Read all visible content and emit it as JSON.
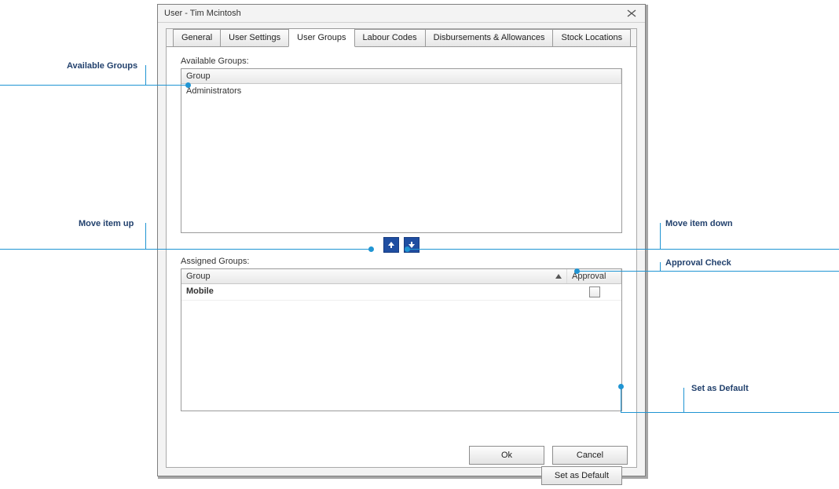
{
  "dialog": {
    "title": "User - Tim Mcintosh"
  },
  "tabs": {
    "items": [
      {
        "label": "General"
      },
      {
        "label": "User Settings"
      },
      {
        "label": "User Groups"
      },
      {
        "label": "Labour Codes"
      },
      {
        "label": "Disbursements & Allowances"
      },
      {
        "label": "Stock Locations"
      }
    ],
    "activeIndex": 2
  },
  "available": {
    "label": "Available Groups:",
    "column": "Group",
    "rows": [
      {
        "name": "Administrators"
      }
    ]
  },
  "assigned": {
    "label": "Assigned Groups:",
    "columns": {
      "group": "Group",
      "approval": "Approval"
    },
    "sort": "asc",
    "rows": [
      {
        "group": "Mobile",
        "approval": false
      }
    ]
  },
  "buttons": {
    "setDefault": "Set as Default",
    "ok": "Ok",
    "cancel": "Cancel"
  },
  "annotations": {
    "availableGroups": "Available Groups",
    "moveUp": "Move item up",
    "moveDown": "Move item down",
    "approvalCheck": "Approval Check",
    "setDefault": "Set as Default"
  }
}
